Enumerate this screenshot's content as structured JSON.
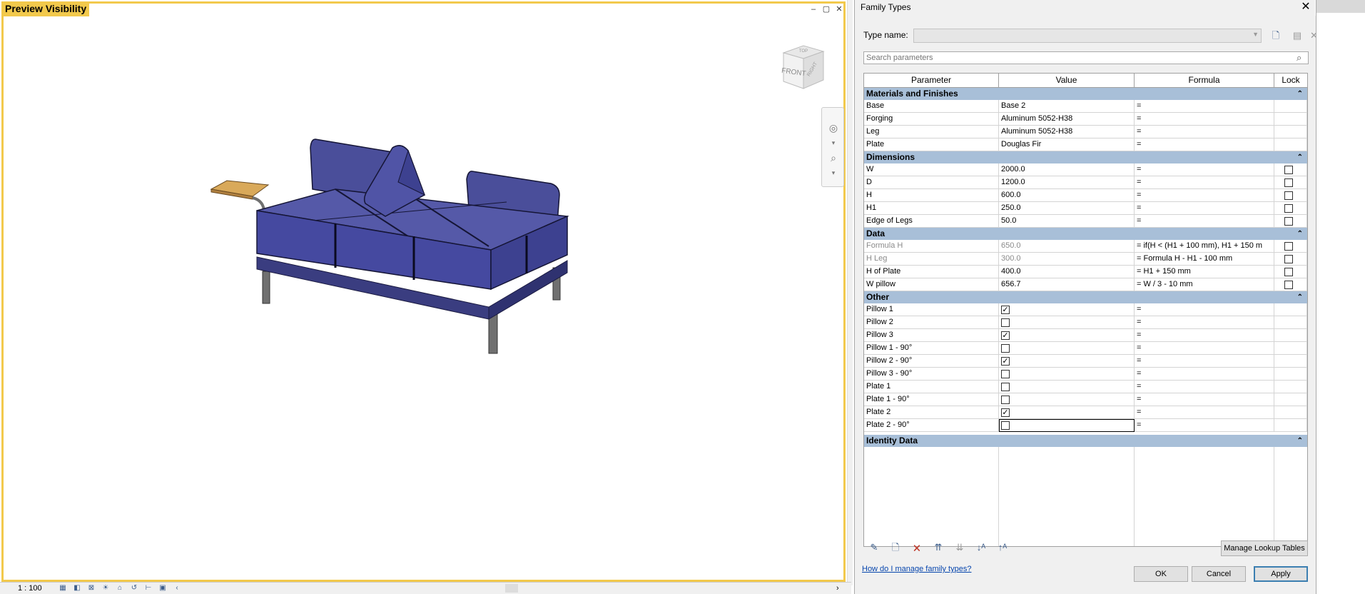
{
  "viewport": {
    "title": "Preview Visibility",
    "window_buttons": [
      "–",
      "▢",
      "✕"
    ],
    "viewcube": {
      "front": "FRONT",
      "top": "TOP",
      "right": "RIGHT"
    },
    "nav_icons": [
      "steering-wheel-icon",
      "zoom-icon"
    ],
    "status": {
      "scale": "1 : 100",
      "controls": [
        "▦",
        "◧",
        "⊠",
        "☀",
        "⌂",
        "↺",
        "⊢",
        "▣",
        "‹"
      ],
      "scroll_arrow": "›"
    }
  },
  "dialog": {
    "title": "Family Types",
    "close": "✕",
    "type_name_label": "Type name:",
    "type_name_value": "",
    "toolbar_icons": [
      "new-type-icon",
      "rename-type-icon",
      "delete-type-icon"
    ],
    "search_placeholder": "Search parameters",
    "columns": [
      "Parameter",
      "Value",
      "Formula",
      "Lock"
    ],
    "sections": {
      "materials": {
        "title": "Materials and Finishes",
        "rows": [
          {
            "name": "Base",
            "value": "Base 2",
            "formula": "="
          },
          {
            "name": "Forging",
            "value": "Aluminum 5052-H38",
            "formula": "="
          },
          {
            "name": "Leg",
            "value": "Aluminum 5052-H38",
            "formula": "="
          },
          {
            "name": "Plate",
            "value": "Douglas Fir",
            "formula": "="
          }
        ]
      },
      "dimensions": {
        "title": "Dimensions",
        "rows": [
          {
            "name": "W",
            "value": "2000.0",
            "formula": "="
          },
          {
            "name": "D",
            "value": "1200.0",
            "formula": "="
          },
          {
            "name": "H",
            "value": "600.0",
            "formula": "="
          },
          {
            "name": "H1",
            "value": "250.0",
            "formula": "="
          },
          {
            "name": "Edge of Legs",
            "value": "50.0",
            "formula": "="
          }
        ]
      },
      "data": {
        "title": "Data",
        "rows": [
          {
            "name": "Formula H",
            "value": "650.0",
            "formula": "= if(H < (H1 + 100 mm), H1 + 150 m"
          },
          {
            "name": "H Leg",
            "value": "300.0",
            "formula": "= Formula H - H1 - 100 mm"
          },
          {
            "name": "H of Plate",
            "value": "400.0",
            "formula": "= H1 + 150 mm"
          },
          {
            "name": "W pillow",
            "value": "656.7",
            "formula": "= W / 3 - 10 mm"
          }
        ]
      },
      "other": {
        "title": "Other",
        "rows": [
          {
            "name": "Pillow 1",
            "checked": true,
            "formula": "="
          },
          {
            "name": "Pillow 2",
            "checked": false,
            "formula": "="
          },
          {
            "name": "Pillow 3",
            "checked": true,
            "formula": "="
          },
          {
            "name": "Pillow 1 - 90°",
            "checked": false,
            "formula": "="
          },
          {
            "name": "Pillow 2 - 90°",
            "checked": true,
            "formula": "="
          },
          {
            "name": "Pillow 3 - 90°",
            "checked": false,
            "formula": "="
          },
          {
            "name": "Plate 1",
            "checked": false,
            "formula": "="
          },
          {
            "name": "Plate 1 - 90°",
            "checked": false,
            "formula": "="
          },
          {
            "name": "Plate 2",
            "checked": true,
            "formula": "="
          },
          {
            "name": "Plate 2 - 90°",
            "checked": false,
            "formula": "="
          }
        ]
      },
      "identity": {
        "title": "Identity Data"
      }
    },
    "collapse_glyph": "⌃",
    "bottom_tool_icons": [
      "edit-parameter-icon",
      "new-parameter-icon",
      "delete-parameter-icon",
      "move-up-icon",
      "move-down-icon",
      "sort-ascending-icon",
      "sort-descending-icon"
    ],
    "manage_lookup_label": "Manage Lookup Tables",
    "help_link": "How do I manage family types?",
    "ok_label": "OK",
    "cancel_label": "Cancel",
    "apply_label": "Apply"
  },
  "colors": {
    "viewport_border": "#f2c94c",
    "section_header": "#a8bfd8",
    "sofa_fabric": "#4a4e9a",
    "plate_wood": "#d9a95a"
  }
}
